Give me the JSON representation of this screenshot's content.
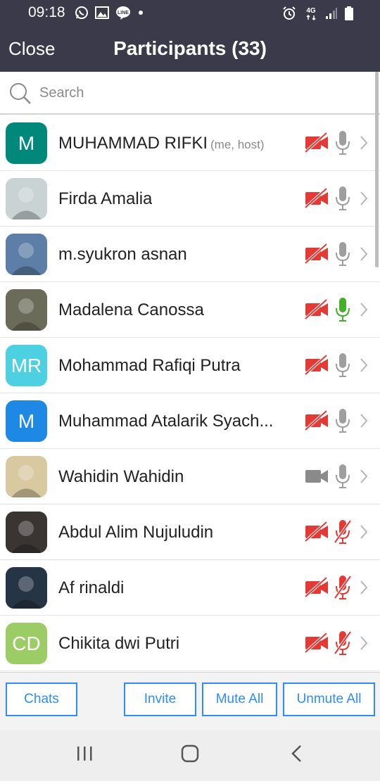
{
  "status_bar": {
    "time": "09:18",
    "network_label": "4G",
    "left_icons": [
      "whatsapp-icon",
      "gallery-icon",
      "line-icon",
      "dot-icon"
    ],
    "right_icons": [
      "alarm-icon",
      "network-4g-icon",
      "signal-icon",
      "battery-icon"
    ]
  },
  "header": {
    "close_label": "Close",
    "title": "Participants (33)"
  },
  "search": {
    "placeholder": "Search",
    "value": ""
  },
  "colors": {
    "header_bg": "#3a3a4a",
    "accent_blue": "#2d8cff",
    "muted_red": "#e53935",
    "active_green": "#43b02a",
    "icon_gray": "#9e9e9e"
  },
  "participants": [
    {
      "name": "MUHAMMAD RIFKI",
      "note": "(me, host)",
      "avatar_initials": "M",
      "avatar_color": "#00897b",
      "avatar_type": "initials",
      "video": "off",
      "mic": "unmuted"
    },
    {
      "name": "Firda Amalia",
      "note": "",
      "avatar_initials": "",
      "avatar_color": "#c9d3d4",
      "avatar_type": "photo",
      "video": "off",
      "mic": "unmuted"
    },
    {
      "name": "m.syukron asnan",
      "note": "",
      "avatar_initials": "",
      "avatar_color": "#5d7ea6",
      "avatar_type": "photo",
      "video": "off",
      "mic": "unmuted"
    },
    {
      "name": "Madalena Canossa",
      "note": "",
      "avatar_initials": "",
      "avatar_color": "#6b6b5a",
      "avatar_type": "photo",
      "video": "off",
      "mic": "speaking"
    },
    {
      "name": "Mohammad Rafiqi Putra",
      "note": "",
      "avatar_initials": "MR",
      "avatar_color": "#4dd0e1",
      "avatar_type": "initials",
      "video": "off",
      "mic": "unmuted"
    },
    {
      "name": "Muhammad Atalarik Syach...",
      "note": "",
      "avatar_initials": "M",
      "avatar_color": "#1e88e5",
      "avatar_type": "initials",
      "video": "off",
      "mic": "unmuted"
    },
    {
      "name": "Wahidin Wahidin",
      "note": "",
      "avatar_initials": "",
      "avatar_color": "#d9c9a0",
      "avatar_type": "photo",
      "video": "on",
      "mic": "unmuted"
    },
    {
      "name": "Abdul Alim Nujuludin",
      "note": "",
      "avatar_initials": "",
      "avatar_color": "#3a3533",
      "avatar_type": "photo",
      "video": "off",
      "mic": "muted"
    },
    {
      "name": "Af rinaldi",
      "note": "",
      "avatar_initials": "",
      "avatar_color": "#263545",
      "avatar_type": "photo",
      "video": "off",
      "mic": "muted"
    },
    {
      "name": "Chikita dwi Putri",
      "note": "",
      "avatar_initials": "CD",
      "avatar_color": "#9ccc65",
      "avatar_type": "initials",
      "video": "off",
      "mic": "muted"
    }
  ],
  "bottom_bar": {
    "chats_label": "Chats",
    "invite_label": "Invite",
    "mute_all_label": "Mute All",
    "unmute_all_label": "Unmute All"
  },
  "nav_bar": {
    "icons": [
      "recent-apps-icon",
      "home-icon",
      "back-icon"
    ]
  }
}
